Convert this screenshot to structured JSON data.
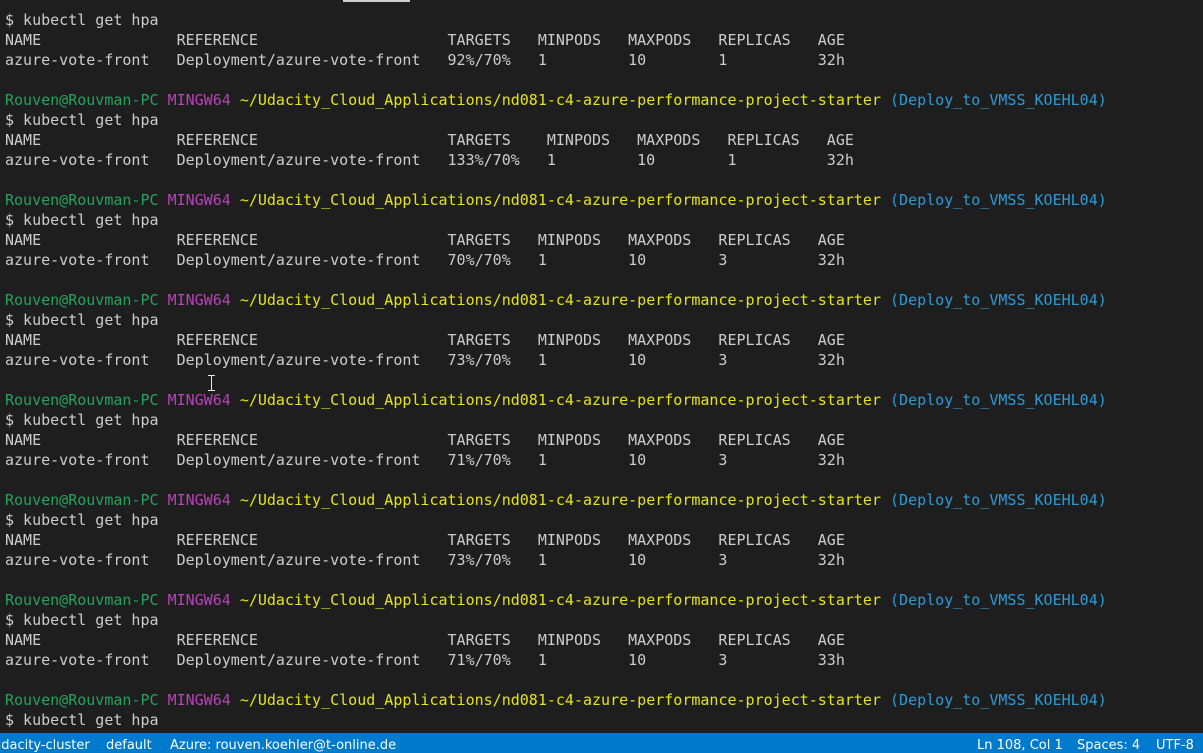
{
  "terminal": {
    "blocks": [
      {
        "command": "$ kubectl get hpa",
        "header": "NAME               REFERENCE                     TARGETS   MINPODS   MAXPODS   REPLICAS   AGE",
        "row": "azure-vote-front   Deployment/azure-vote-front   92%/70%   1         10        1          32h"
      },
      {
        "prompt": {
          "user": "Rouven@Rouvman-PC",
          "system": "MINGW64",
          "path": "~/Udacity_Cloud_Applications/nd081-c4-azure-performance-project-starter",
          "branch": "(Deploy_to_VMSS_KOEHL04)"
        },
        "command": "$ kubectl get hpa",
        "header": "NAME               REFERENCE                     TARGETS    MINPODS   MAXPODS   REPLICAS   AGE",
        "row": "azure-vote-front   Deployment/azure-vote-front   133%/70%   1         10        1          32h"
      },
      {
        "prompt": {
          "user": "Rouven@Rouvman-PC",
          "system": "MINGW64",
          "path": "~/Udacity_Cloud_Applications/nd081-c4-azure-performance-project-starter",
          "branch": "(Deploy_to_VMSS_KOEHL04)"
        },
        "command": "$ kubectl get hpa",
        "header": "NAME               REFERENCE                     TARGETS   MINPODS   MAXPODS   REPLICAS   AGE",
        "row": "azure-vote-front   Deployment/azure-vote-front   70%/70%   1         10        3          32h"
      },
      {
        "prompt": {
          "user": "Rouven@Rouvman-PC",
          "system": "MINGW64",
          "path": "~/Udacity_Cloud_Applications/nd081-c4-azure-performance-project-starter",
          "branch": "(Deploy_to_VMSS_KOEHL04)"
        },
        "command": "$ kubectl get hpa",
        "header": "NAME               REFERENCE                     TARGETS   MINPODS   MAXPODS   REPLICAS   AGE",
        "row": "azure-vote-front   Deployment/azure-vote-front   73%/70%   1         10        3          32h"
      },
      {
        "prompt": {
          "user": "Rouven@Rouvman-PC",
          "system": "MINGW64",
          "path": "~/Udacity_Cloud_Applications/nd081-c4-azure-performance-project-starter",
          "branch": "(Deploy_to_VMSS_KOEHL04)"
        },
        "command": "$ kubectl get hpa",
        "header": "NAME               REFERENCE                     TARGETS   MINPODS   MAXPODS   REPLICAS   AGE",
        "row": "azure-vote-front   Deployment/azure-vote-front   71%/70%   1         10        3          32h"
      },
      {
        "prompt": {
          "user": "Rouven@Rouvman-PC",
          "system": "MINGW64",
          "path": "~/Udacity_Cloud_Applications/nd081-c4-azure-performance-project-starter",
          "branch": "(Deploy_to_VMSS_KOEHL04)"
        },
        "command": "$ kubectl get hpa",
        "header": "NAME               REFERENCE                     TARGETS   MINPODS   MAXPODS   REPLICAS   AGE",
        "row": "azure-vote-front   Deployment/azure-vote-front   73%/70%   1         10        3          32h"
      },
      {
        "prompt": {
          "user": "Rouven@Rouvman-PC",
          "system": "MINGW64",
          "path": "~/Udacity_Cloud_Applications/nd081-c4-azure-performance-project-starter",
          "branch": "(Deploy_to_VMSS_KOEHL04)"
        },
        "command": "$ kubectl get hpa",
        "header": "NAME               REFERENCE                     TARGETS   MINPODS   MAXPODS   REPLICAS   AGE",
        "row": "azure-vote-front   Deployment/azure-vote-front   71%/70%   1         10        3          33h"
      },
      {
        "prompt": {
          "user": "Rouven@Rouvman-PC",
          "system": "MINGW64",
          "path": "~/Udacity_Cloud_Applications/nd081-c4-azure-performance-project-starter",
          "branch": "(Deploy_to_VMSS_KOEHL04)"
        },
        "command": "$ kubectl get hpa"
      }
    ]
  },
  "statusbar": {
    "cluster": "udacity-cluster",
    "namespace": "default",
    "azure": "Azure: rouven.koehler@t-online.de",
    "position": "Ln 108, Col 1",
    "spaces": "Spaces: 4",
    "encoding": "UTF-8"
  },
  "colors": {
    "background": "#1e1e1e",
    "text": "#cccccc",
    "prompt_user": "#23a35d",
    "prompt_system": "#bc3fbc",
    "prompt_path": "#e5e510",
    "prompt_branch": "#2a9ad6",
    "statusbar": "#007acc"
  }
}
